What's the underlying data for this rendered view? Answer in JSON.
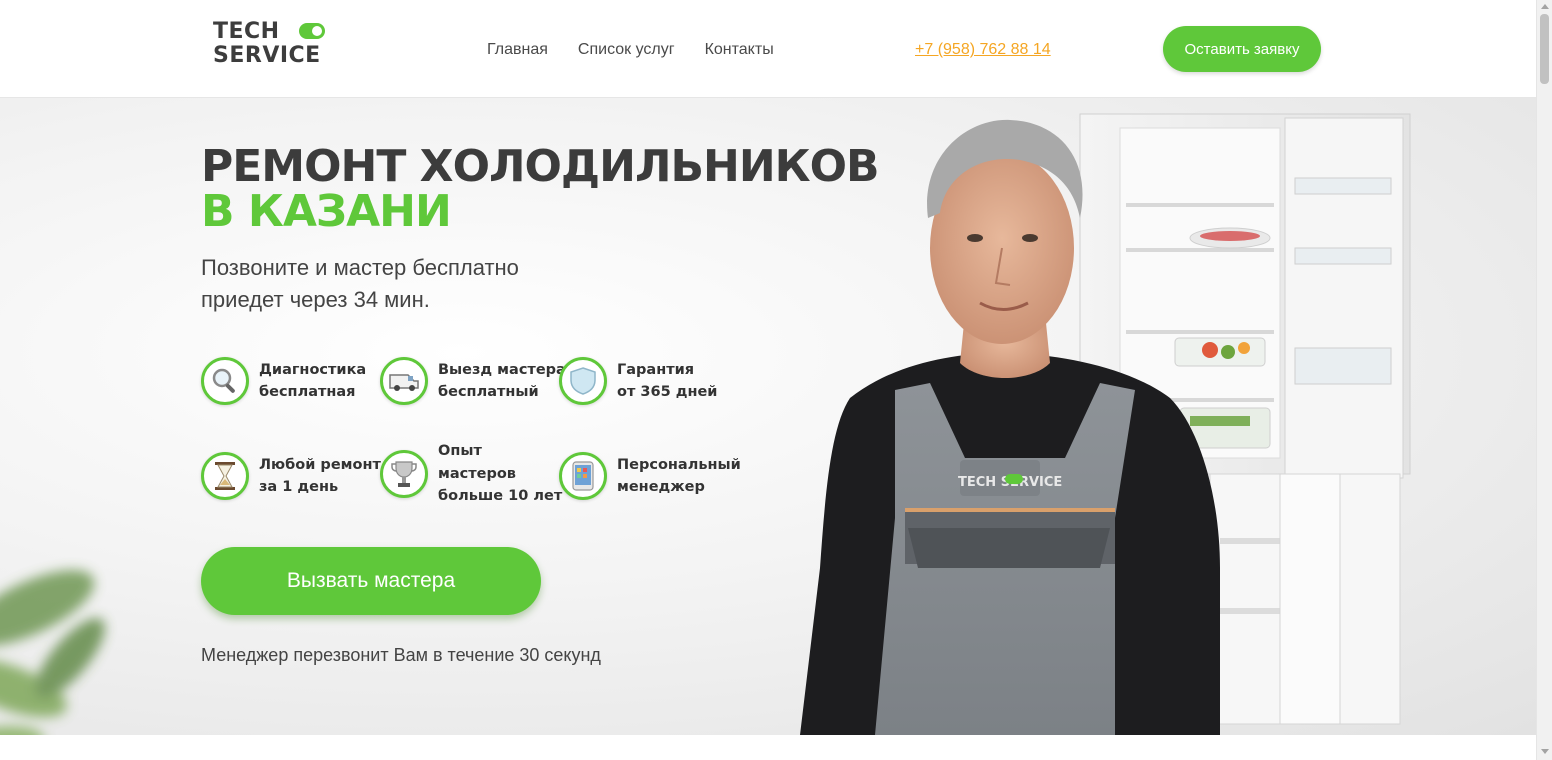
{
  "header": {
    "logo": {
      "line1": "TECH",
      "line2": "SERVICE"
    },
    "nav": [
      "Главная",
      "Список услуг",
      "Контакты"
    ],
    "phone": "+7 (958) 762 88 14",
    "request_button": "Оставить заявку"
  },
  "hero": {
    "title": "РЕМОНТ ХОЛОДИЛЬНИКОВ",
    "title_accent": "В КАЗАНИ",
    "subtitle_line1": "Позвоните и мастер бесплатно",
    "subtitle_line2": "приедет через 34 мин.",
    "features": [
      {
        "icon": "magnifier-icon",
        "lines": [
          "Диагностика",
          "бесплатная"
        ]
      },
      {
        "icon": "van-icon",
        "lines": [
          "Выезд мастера",
          "бесплатный"
        ]
      },
      {
        "icon": "shield-icon",
        "lines": [
          "Гарантия",
          "от 365 дней"
        ]
      },
      {
        "icon": "hourglass-icon",
        "lines": [
          "Любой ремонт",
          "за 1 день"
        ]
      },
      {
        "icon": "trophy-icon",
        "lines": [
          "Опыт",
          "мастеров",
          "больше 10 лет"
        ]
      },
      {
        "icon": "smartphone-icon",
        "lines": [
          "Персональный",
          "менеджер"
        ]
      }
    ],
    "call_button": "Вызвать мастера",
    "callback_note": "Менеджер перезвонит Вам в течение 30 секунд",
    "uniform_logo": "TECH SERVICE"
  },
  "colors": {
    "accent": "#5fc83a",
    "phone": "#f5a623",
    "text": "#3c3c3c"
  }
}
